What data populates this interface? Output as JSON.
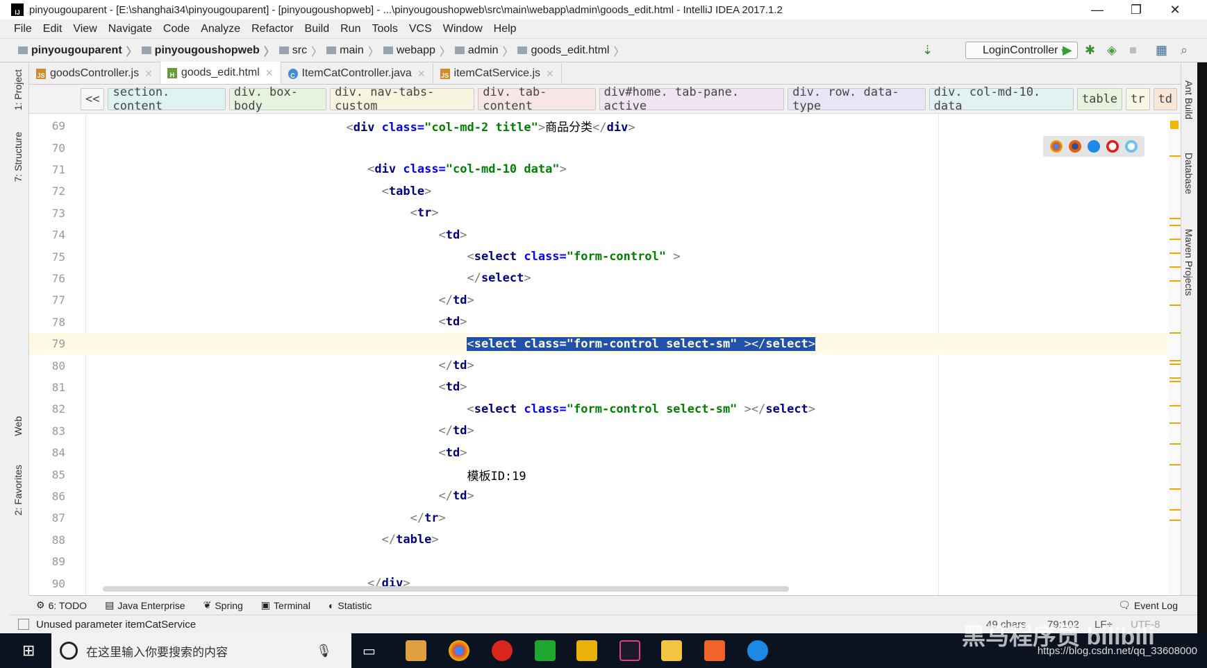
{
  "window": {
    "title": "pinyougouparent - [E:\\shanghai34\\pinyougouparent] - [pinyougoushopweb] - ...\\pinyougoushopweb\\src\\main\\webapp\\admin\\goods_edit.html - IntelliJ IDEA 2017.1.2",
    "logo": "IJ",
    "minimize": "—",
    "restore": "❐",
    "close": "✕"
  },
  "menu": [
    "File",
    "Edit",
    "View",
    "Navigate",
    "Code",
    "Analyze",
    "Refactor",
    "Build",
    "Run",
    "Tools",
    "VCS",
    "Window",
    "Help"
  ],
  "breadcrumb": [
    {
      "label": "pinyougouparent",
      "bold": true
    },
    {
      "label": "pinyougoushopweb",
      "bold": true
    },
    {
      "label": "src"
    },
    {
      "label": "main"
    },
    {
      "label": "webapp"
    },
    {
      "label": "admin"
    },
    {
      "label": "goods_edit.html"
    }
  ],
  "toolbar": {
    "run_config": "LoginController",
    "run_config_arrow": "▾"
  },
  "tabs": [
    {
      "label": "goodsController.js",
      "icon": "JS",
      "color": "#d08a2a",
      "active": false
    },
    {
      "label": "goods_edit.html",
      "icon": "H",
      "color": "#6a9a3a",
      "active": true
    },
    {
      "label": "ItemCatController.java",
      "icon": "C",
      "color": "#3d8ed6",
      "active": false
    },
    {
      "label": "itemCatService.js",
      "icon": "JS",
      "color": "#d08a2a",
      "active": false
    }
  ],
  "tag_breadcrumb": {
    "back": "<<",
    "items": [
      {
        "label": "section. content",
        "color": "#e0f3f3"
      },
      {
        "label": "div. box-body",
        "color": "#e6f4df"
      },
      {
        "label": "div. nav-tabs-custom",
        "color": "#f7f5e0"
      },
      {
        "label": "div. tab-content",
        "color": "#f8e6e6"
      },
      {
        "label": "div#home. tab-pane. active",
        "color": "#f1e4f3"
      },
      {
        "label": "div. row. data-type",
        "color": "#e6e6f6"
      },
      {
        "label": "div. col-md-10. data",
        "color": "#e2f2f2"
      },
      {
        "label": "table",
        "color": "#e6f4df"
      },
      {
        "label": "tr",
        "color": "#f8f6e4"
      },
      {
        "label": "td",
        "color": "#fae6d6"
      }
    ]
  },
  "left_tools": [
    "1: Project",
    "7: Structure",
    "Web",
    "2: Favorites"
  ],
  "right_tools": [
    "Ant Build",
    "Database",
    "Maven Projects"
  ],
  "editor": {
    "current_line": 79,
    "lines": [
      {
        "n": "69",
        "s": [
          [
            "                                    ",
            "txt"
          ],
          [
            "<",
            "br"
          ],
          [
            "div ",
            "tag"
          ],
          [
            "class=",
            "attr"
          ],
          [
            "\"col-md-2 title\"",
            "val"
          ],
          [
            ">",
            "br"
          ],
          [
            "商品分类",
            "txt"
          ],
          [
            "</",
            "br"
          ],
          [
            "div",
            "tag"
          ],
          [
            ">",
            "br"
          ]
        ]
      },
      {
        "n": "70",
        "s": []
      },
      {
        "n": "71",
        "s": [
          [
            "                                       ",
            "txt"
          ],
          [
            "<",
            "br"
          ],
          [
            "div ",
            "tag"
          ],
          [
            "class=",
            "attr"
          ],
          [
            "\"col-md-10 data\"",
            "val"
          ],
          [
            ">",
            "br"
          ]
        ]
      },
      {
        "n": "72",
        "s": [
          [
            "                                         ",
            "txt"
          ],
          [
            "<",
            "br"
          ],
          [
            "table",
            "tag"
          ],
          [
            ">",
            "br"
          ]
        ]
      },
      {
        "n": "73",
        "s": [
          [
            "                                             ",
            "txt"
          ],
          [
            "<",
            "br"
          ],
          [
            "tr",
            "tag"
          ],
          [
            ">",
            "br"
          ]
        ]
      },
      {
        "n": "74",
        "s": [
          [
            "                                                 ",
            "txt"
          ],
          [
            "<",
            "br"
          ],
          [
            "td",
            "tag"
          ],
          [
            ">",
            "br"
          ]
        ]
      },
      {
        "n": "75",
        "s": [
          [
            "                                                     ",
            "txt"
          ],
          [
            "<",
            "br"
          ],
          [
            "select ",
            "tag"
          ],
          [
            "class=",
            "attr"
          ],
          [
            "\"form-control\"",
            "val"
          ],
          [
            " >",
            "br"
          ]
        ]
      },
      {
        "n": "76",
        "s": [
          [
            "                                                     ",
            "txt"
          ],
          [
            "</",
            "br"
          ],
          [
            "select",
            "tag"
          ],
          [
            ">",
            "br"
          ]
        ]
      },
      {
        "n": "77",
        "s": [
          [
            "                                                 ",
            "txt"
          ],
          [
            "</",
            "br"
          ],
          [
            "td",
            "tag"
          ],
          [
            ">",
            "br"
          ]
        ]
      },
      {
        "n": "78",
        "s": [
          [
            "                                                 ",
            "txt"
          ],
          [
            "<",
            "br"
          ],
          [
            "td",
            "tag"
          ],
          [
            ">",
            "br"
          ]
        ]
      },
      {
        "n": "79",
        "s": [
          [
            "                                                     ",
            "txt"
          ],
          [
            "<",
            "br sel"
          ],
          [
            "select ",
            "tag sel"
          ],
          [
            "class=",
            "attr sel"
          ],
          [
            "\"form-control select-sm\"",
            "val sel"
          ],
          [
            " ></",
            "br sel"
          ],
          [
            "select",
            "tag sel"
          ],
          [
            ">",
            "br sel"
          ]
        ]
      },
      {
        "n": "80",
        "s": [
          [
            "                                                 ",
            "txt"
          ],
          [
            "</",
            "br"
          ],
          [
            "td",
            "tag"
          ],
          [
            ">",
            "br"
          ]
        ]
      },
      {
        "n": "81",
        "s": [
          [
            "                                                 ",
            "txt"
          ],
          [
            "<",
            "br"
          ],
          [
            "td",
            "tag"
          ],
          [
            ">",
            "br"
          ]
        ]
      },
      {
        "n": "82",
        "s": [
          [
            "                                                     ",
            "txt"
          ],
          [
            "<",
            "br"
          ],
          [
            "select ",
            "tag"
          ],
          [
            "class=",
            "attr"
          ],
          [
            "\"form-control select-sm\"",
            "val"
          ],
          [
            " ></",
            "br"
          ],
          [
            "select",
            "tag"
          ],
          [
            ">",
            "br"
          ]
        ]
      },
      {
        "n": "83",
        "s": [
          [
            "                                                 ",
            "txt"
          ],
          [
            "</",
            "br"
          ],
          [
            "td",
            "tag"
          ],
          [
            ">",
            "br"
          ]
        ]
      },
      {
        "n": "84",
        "s": [
          [
            "                                                 ",
            "txt"
          ],
          [
            "<",
            "br"
          ],
          [
            "td",
            "tag"
          ],
          [
            ">",
            "br"
          ]
        ]
      },
      {
        "n": "85",
        "s": [
          [
            "                                                     ",
            "txt"
          ],
          [
            "模板ID:19",
            "txt"
          ]
        ]
      },
      {
        "n": "86",
        "s": [
          [
            "                                                 ",
            "txt"
          ],
          [
            "</",
            "br"
          ],
          [
            "td",
            "tag"
          ],
          [
            ">",
            "br"
          ]
        ]
      },
      {
        "n": "87",
        "s": [
          [
            "                                             ",
            "txt"
          ],
          [
            "</",
            "br"
          ],
          [
            "tr",
            "tag"
          ],
          [
            ">",
            "br"
          ]
        ]
      },
      {
        "n": "88",
        "s": [
          [
            "                                         ",
            "txt"
          ],
          [
            "</",
            "br"
          ],
          [
            "table",
            "tag"
          ],
          [
            ">",
            "br"
          ]
        ]
      },
      {
        "n": "89",
        "s": []
      },
      {
        "n": "90",
        "s": [
          [
            "                                       ",
            "txt"
          ],
          [
            "</",
            "br"
          ],
          [
            "div",
            "tag"
          ],
          [
            ">",
            "br"
          ]
        ]
      }
    ]
  },
  "bottom_tools": [
    {
      "label": "6: TODO",
      "icon": "todo-icon"
    },
    {
      "label": "Java Enterprise",
      "icon": "java-enterprise-icon"
    },
    {
      "label": "Spring",
      "icon": "spring-icon"
    },
    {
      "label": "Terminal",
      "icon": "terminal-icon"
    },
    {
      "label": "Statistic",
      "icon": "statistic-icon"
    }
  ],
  "event_log": "Event Log",
  "status": {
    "message": "Unused parameter itemCatService",
    "chars": "49 chars",
    "position": "79:102",
    "line_sep": "LF÷",
    "encoding": "UTF-8"
  },
  "taskbar": {
    "search_placeholder": "在这里输入你要搜索的内容"
  },
  "watermark": {
    "url": "https://blog.csdn.net/qq_33608000",
    "brand": "黑马程序员 bilibili"
  }
}
